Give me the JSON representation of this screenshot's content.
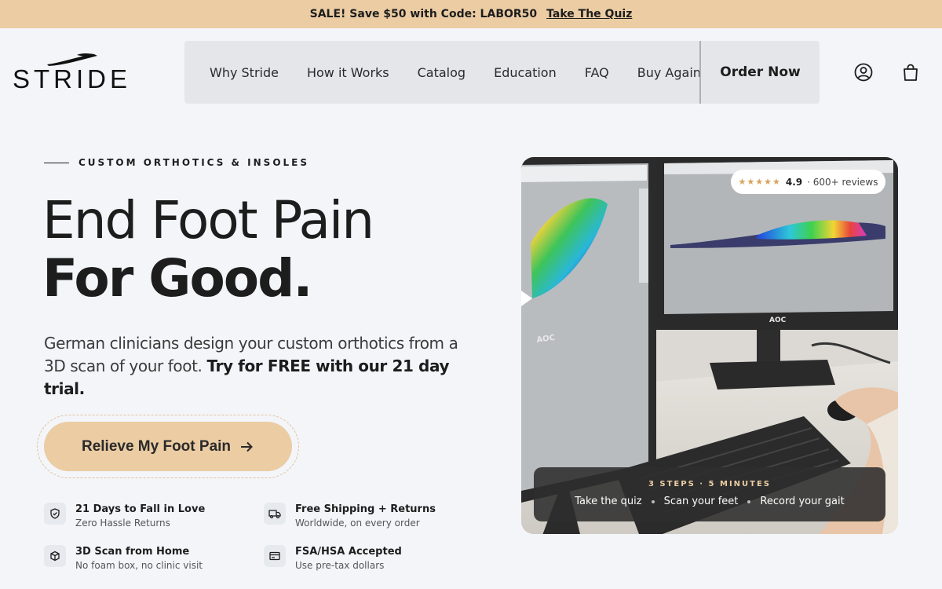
{
  "announcement": {
    "text": "SALE! Save $50 with Code: LABOR50",
    "link": "Take The Quiz"
  },
  "brand": {
    "name": "STRIDE"
  },
  "nav": {
    "links": [
      "Why Stride",
      "How it Works",
      "Catalog",
      "Education",
      "FAQ",
      "Buy Again"
    ],
    "order": "Order Now"
  },
  "hero": {
    "eyebrow": "CUSTOM ORTHOTICS & INSOLES",
    "headline_1": "End Foot Pain",
    "headline_2": "For Good.",
    "desc_plain": "German clinicians design your custom orthotics from a 3D scan of your foot.",
    "desc_bold": "Try for FREE with our 21 day trial.",
    "cta": "Relieve My Foot Pain"
  },
  "features": [
    {
      "title": "21 Days to Fall in Love",
      "sub": "Zero Hassle Returns",
      "icon": "shield-check-icon"
    },
    {
      "title": "Free Shipping + Returns",
      "sub": "Worldwide, on every order",
      "icon": "truck-icon"
    },
    {
      "title": "3D Scan from Home",
      "sub": "No foam box, no clinic visit",
      "icon": "cube-icon"
    },
    {
      "title": "FSA/HSA Accepted",
      "sub": "Use pre-tax dollars",
      "icon": "card-icon"
    }
  ],
  "rating": {
    "stars": "★★★★★",
    "score": "4.9",
    "reviews": "· 600+ reviews"
  },
  "steps": {
    "label": "3 STEPS · 5 MINUTES",
    "items": [
      "Take the quiz",
      "Scan your feet",
      "Record your gait"
    ]
  },
  "monitor_brand": "AOC",
  "colors": {
    "accent": "#ebcca3",
    "background": "#f3f5f9",
    "nav": "#e4e6ea",
    "text": "#1d1d1d"
  }
}
